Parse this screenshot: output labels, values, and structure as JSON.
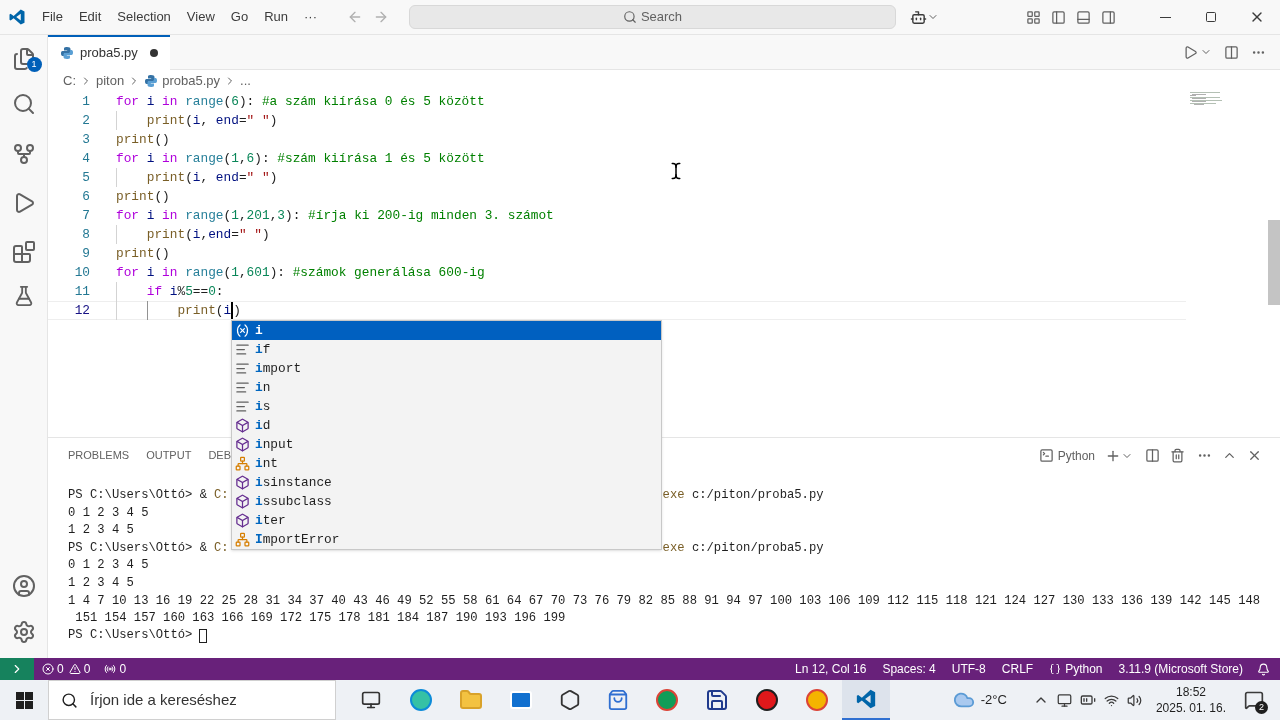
{
  "menu": [
    "File",
    "Edit",
    "Selection",
    "View",
    "Go",
    "Run",
    "···"
  ],
  "search": {
    "placeholder": "Search"
  },
  "activity_badge": "1",
  "tab": {
    "label": "proba5.py",
    "modified": true
  },
  "breadcrumb": [
    "C:",
    "piton",
    "proba5.py",
    "..."
  ],
  "code": [
    {
      "number": "1",
      "current": false,
      "tokens": [
        {
          "kind": "kw",
          "t": "for"
        },
        {
          "kind": "var",
          "t": " i"
        },
        {
          "kind": "kw",
          "t": " in"
        },
        {
          "kind": "cls",
          "t": " range"
        },
        {
          "kind": "pl",
          "t": "("
        },
        {
          "kind": "num",
          "t": "6"
        },
        {
          "kind": "pl",
          "t": "):"
        },
        {
          "kind": "cm",
          "t": " #a szám kiírása 0 és 5 között"
        }
      ]
    },
    {
      "number": "2",
      "current": false,
      "tokens": [
        {
          "kind": "fn",
          "t": "    print"
        },
        {
          "kind": "pl",
          "t": "("
        },
        {
          "kind": "var",
          "t": "i"
        },
        {
          "kind": "pl",
          "t": ","
        },
        {
          "kind": "var",
          "t": " end"
        },
        {
          "kind": "pl",
          "t": "="
        },
        {
          "kind": "str",
          "t": "\" \""
        },
        {
          "kind": "pl",
          "t": ")"
        }
      ]
    },
    {
      "number": "3",
      "current": false,
      "tokens": [
        {
          "kind": "fn",
          "t": "print"
        },
        {
          "kind": "pl",
          "t": "()"
        }
      ]
    },
    {
      "number": "4",
      "current": false,
      "tokens": [
        {
          "kind": "kw",
          "t": "for"
        },
        {
          "kind": "var",
          "t": " i"
        },
        {
          "kind": "kw",
          "t": " in"
        },
        {
          "kind": "cls",
          "t": " range"
        },
        {
          "kind": "pl",
          "t": "("
        },
        {
          "kind": "num",
          "t": "1"
        },
        {
          "kind": "pl",
          "t": ","
        },
        {
          "kind": "num",
          "t": "6"
        },
        {
          "kind": "pl",
          "t": "):"
        },
        {
          "kind": "cm",
          "t": " #szám kiírása 1 és 5 között"
        }
      ]
    },
    {
      "number": "5",
      "current": false,
      "tokens": [
        {
          "kind": "fn",
          "t": "    print"
        },
        {
          "kind": "pl",
          "t": "("
        },
        {
          "kind": "var",
          "t": "i"
        },
        {
          "kind": "pl",
          "t": ","
        },
        {
          "kind": "var",
          "t": " end"
        },
        {
          "kind": "pl",
          "t": "="
        },
        {
          "kind": "str",
          "t": "\" \""
        },
        {
          "kind": "pl",
          "t": ")"
        }
      ]
    },
    {
      "number": "6",
      "current": false,
      "tokens": [
        {
          "kind": "fn",
          "t": "print"
        },
        {
          "kind": "pl",
          "t": "()"
        }
      ]
    },
    {
      "number": "7",
      "current": false,
      "tokens": [
        {
          "kind": "kw",
          "t": "for"
        },
        {
          "kind": "var",
          "t": " i"
        },
        {
          "kind": "kw",
          "t": " in"
        },
        {
          "kind": "cls",
          "t": " range"
        },
        {
          "kind": "pl",
          "t": "("
        },
        {
          "kind": "num",
          "t": "1"
        },
        {
          "kind": "pl",
          "t": ","
        },
        {
          "kind": "num",
          "t": "201"
        },
        {
          "kind": "pl",
          "t": ","
        },
        {
          "kind": "num",
          "t": "3"
        },
        {
          "kind": "pl",
          "t": "):"
        },
        {
          "kind": "cm",
          "t": " #írja ki 200-ig minden 3. számot"
        }
      ]
    },
    {
      "number": "8",
      "current": false,
      "tokens": [
        {
          "kind": "fn",
          "t": "    print"
        },
        {
          "kind": "pl",
          "t": "("
        },
        {
          "kind": "var",
          "t": "i"
        },
        {
          "kind": "pl",
          "t": ","
        },
        {
          "kind": "var",
          "t": "end"
        },
        {
          "kind": "pl",
          "t": "="
        },
        {
          "kind": "str",
          "t": "\" \""
        },
        {
          "kind": "pl",
          "t": ")"
        }
      ]
    },
    {
      "number": "9",
      "current": false,
      "tokens": [
        {
          "kind": "fn",
          "t": "print"
        },
        {
          "kind": "pl",
          "t": "()"
        }
      ]
    },
    {
      "number": "10",
      "current": false,
      "tokens": [
        {
          "kind": "kw",
          "t": "for"
        },
        {
          "kind": "var",
          "t": " i"
        },
        {
          "kind": "kw",
          "t": " in"
        },
        {
          "kind": "cls",
          "t": " range"
        },
        {
          "kind": "pl",
          "t": "("
        },
        {
          "kind": "num",
          "t": "1"
        },
        {
          "kind": "pl",
          "t": ","
        },
        {
          "kind": "num",
          "t": "601"
        },
        {
          "kind": "pl",
          "t": "):"
        },
        {
          "kind": "cm",
          "t": " #számok generálása 600-ig"
        }
      ]
    },
    {
      "number": "11",
      "current": false,
      "tokens": [
        {
          "kind": "kw",
          "t": "    if"
        },
        {
          "kind": "var",
          "t": " i"
        },
        {
          "kind": "pl",
          "t": "%"
        },
        {
          "kind": "num",
          "t": "5"
        },
        {
          "kind": "pl",
          "t": "=="
        },
        {
          "kind": "num",
          "t": "0"
        },
        {
          "kind": "pl",
          "t": ":"
        }
      ]
    },
    {
      "number": "12",
      "current": true,
      "tokens": [
        {
          "kind": "fn",
          "t": "        print"
        },
        {
          "kind": "pl",
          "t": "("
        },
        {
          "kind": "var",
          "t": "i"
        },
        {
          "kind": "cursor"
        },
        {
          "kind": "pl",
          "t": ")"
        }
      ]
    }
  ],
  "suggestions": [
    {
      "kind": "variable",
      "match": "i",
      "selected": true
    },
    {
      "kind": "keyword",
      "match": "i",
      "rest": "f",
      "selected": false
    },
    {
      "kind": "keyword",
      "match": "i",
      "rest": "mport",
      "selected": false
    },
    {
      "kind": "keyword",
      "match": "i",
      "rest": "n",
      "selected": false
    },
    {
      "kind": "keyword",
      "match": "i",
      "rest": "s",
      "selected": false
    },
    {
      "kind": "function",
      "match": "i",
      "rest": "d",
      "selected": false
    },
    {
      "kind": "function",
      "match": "i",
      "rest": "nput",
      "selected": false
    },
    {
      "kind": "class",
      "match": "i",
      "rest": "nt",
      "selected": false
    },
    {
      "kind": "function",
      "match": "i",
      "rest": "sinstance",
      "selected": false
    },
    {
      "kind": "function",
      "match": "i",
      "rest": "ssubclass",
      "selected": false
    },
    {
      "kind": "function",
      "match": "i",
      "rest": "ter",
      "selected": false
    },
    {
      "kind": "class",
      "match": "I",
      "rest": "mportError",
      "selected": false
    }
  ],
  "panel_tabs": [
    "PROBLEMS",
    "OUTPUT",
    "DEB"
  ],
  "terminal_label": "Python",
  "terminal": [
    {
      "kind": "command",
      "prompt": "PS C:\\Users\\Ottó> &",
      "path": "C:",
      "tail": "exe c:/piton/proba5.py"
    },
    {
      "kind": "output",
      "text": "0 1 2 3 4 5"
    },
    {
      "kind": "output",
      "text": "1 2 3 4 5"
    },
    {
      "kind": "command",
      "prompt": "PS C:\\Users\\Ottó> &",
      "path": "C:",
      "tail": "exe c:/piton/proba5.py"
    },
    {
      "kind": "output",
      "text": "0 1 2 3 4 5"
    },
    {
      "kind": "output",
      "text": "1 2 3 4 5"
    },
    {
      "kind": "output",
      "text": "1 4 7 10 13 16 19 22 25 28 31 34 37 40 43 46 49 52 55 58 61 64 67 70 73 76 79 82 85 88 91 94 97 100 103 106 109 112 115 118 121 124 127 130 133 136 139 142 145 148"
    },
    {
      "kind": "output",
      "text": " 151 154 157 160 163 166 169 172 175 178 181 184 187 190 193 196 199"
    },
    {
      "kind": "prompt",
      "text": "PS C:\\Users\\Ottó>"
    }
  ],
  "status": {
    "errors": "0",
    "warnings": "0",
    "ports": "0",
    "right": [
      "Ln 12, Col 16",
      "Spaces: 4",
      "UTF-8",
      "CRLF"
    ],
    "language": "Python",
    "interpreter": "3.11.9 (Microsoft Store)"
  },
  "taskbar": {
    "search_placeholder": "Írjon ide a kereséshez",
    "temperature": "-2°C",
    "time": "18:52",
    "date": "2025. 01. 16.",
    "notifications": "2"
  }
}
